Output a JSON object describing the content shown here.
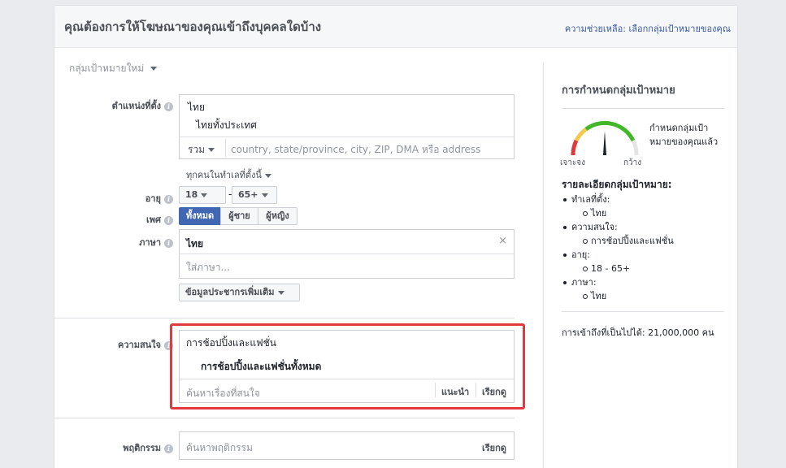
{
  "header": {
    "title": "คุณต้องการให้โฆษณาของคุณเข้าถึงบุคคลใดบ้าง",
    "help": "ความช่วยเหลือ: เลือกกลุ่มเป้าหมายของคุณ"
  },
  "audience_dropdown": "กลุ่มเป้าหมายใหม่",
  "location": {
    "label": "ตำแหน่งที่ตั้ง",
    "country": "ไทย",
    "entry": "ไทยทั้งประเทศ",
    "include_label": "รวม",
    "placeholder": "country, state/province, city, ZIP, DMA หรือ address",
    "scope": "ทุกคนในทำเลที่ตั้งนี้"
  },
  "age": {
    "label": "อายุ",
    "min": "18",
    "separator": "-",
    "max": "65+"
  },
  "gender": {
    "label": "เพศ",
    "options": [
      "ทั้งหมด",
      "ผู้ชาย",
      "ผู้หญิง"
    ]
  },
  "language": {
    "label": "ภาษา",
    "selected": "ไทย",
    "remove": "×",
    "placeholder": "ใส่ภาษา..."
  },
  "more_demographics": "ข้อมูลประชากรเพิ่มเติม",
  "interests": {
    "label": "ความสนใจ",
    "category": "การช้อปปิ้งและแฟชั่น",
    "item": "การช้อปปิ้งและแฟชั่นทั้งหมด",
    "placeholder": "ค้นหาเรื่องที่สนใจ",
    "suggest": "แนะนำ",
    "browse": "เรียกดู"
  },
  "behaviors": {
    "label": "พฤติกรรม",
    "placeholder": "ค้นหาพฤติกรรม",
    "browse": "เรียกดู"
  },
  "sidebar": {
    "title": "การกำหนดกลุ่มเป้าหมาย",
    "gauge_text_1": "กำหนดกลุ่มเป้า",
    "gauge_text_2": "หมายของคุณแล้ว",
    "gauge_left": "เจาะจง",
    "gauge_right": "กว้าง",
    "details_title": "รายละเอียดกลุ่มเป้าหมาย:",
    "details": [
      {
        "label": "ทำเลที่ตั้ง:",
        "value": "ไทย"
      },
      {
        "label": "ความสนใจ:",
        "value": "การช้อปปิ้งและแฟชั่น"
      },
      {
        "label": "อายุ:",
        "value": "18 - 65+"
      },
      {
        "label": "ภาษา:",
        "value": "ไทย"
      }
    ],
    "reach": "การเข้าถึงที่เป็นไปได้: 21,000,000 คน"
  },
  "colors": {
    "accent": "#4267b2",
    "highlight": "#e0393e",
    "gauge_red": "#e0393e",
    "gauge_yellow": "#f2c94c",
    "gauge_green": "#42b72a"
  },
  "icons": {
    "info": "info-icon",
    "caret": "chevron-down-icon",
    "needle": "gauge-needle-icon"
  }
}
